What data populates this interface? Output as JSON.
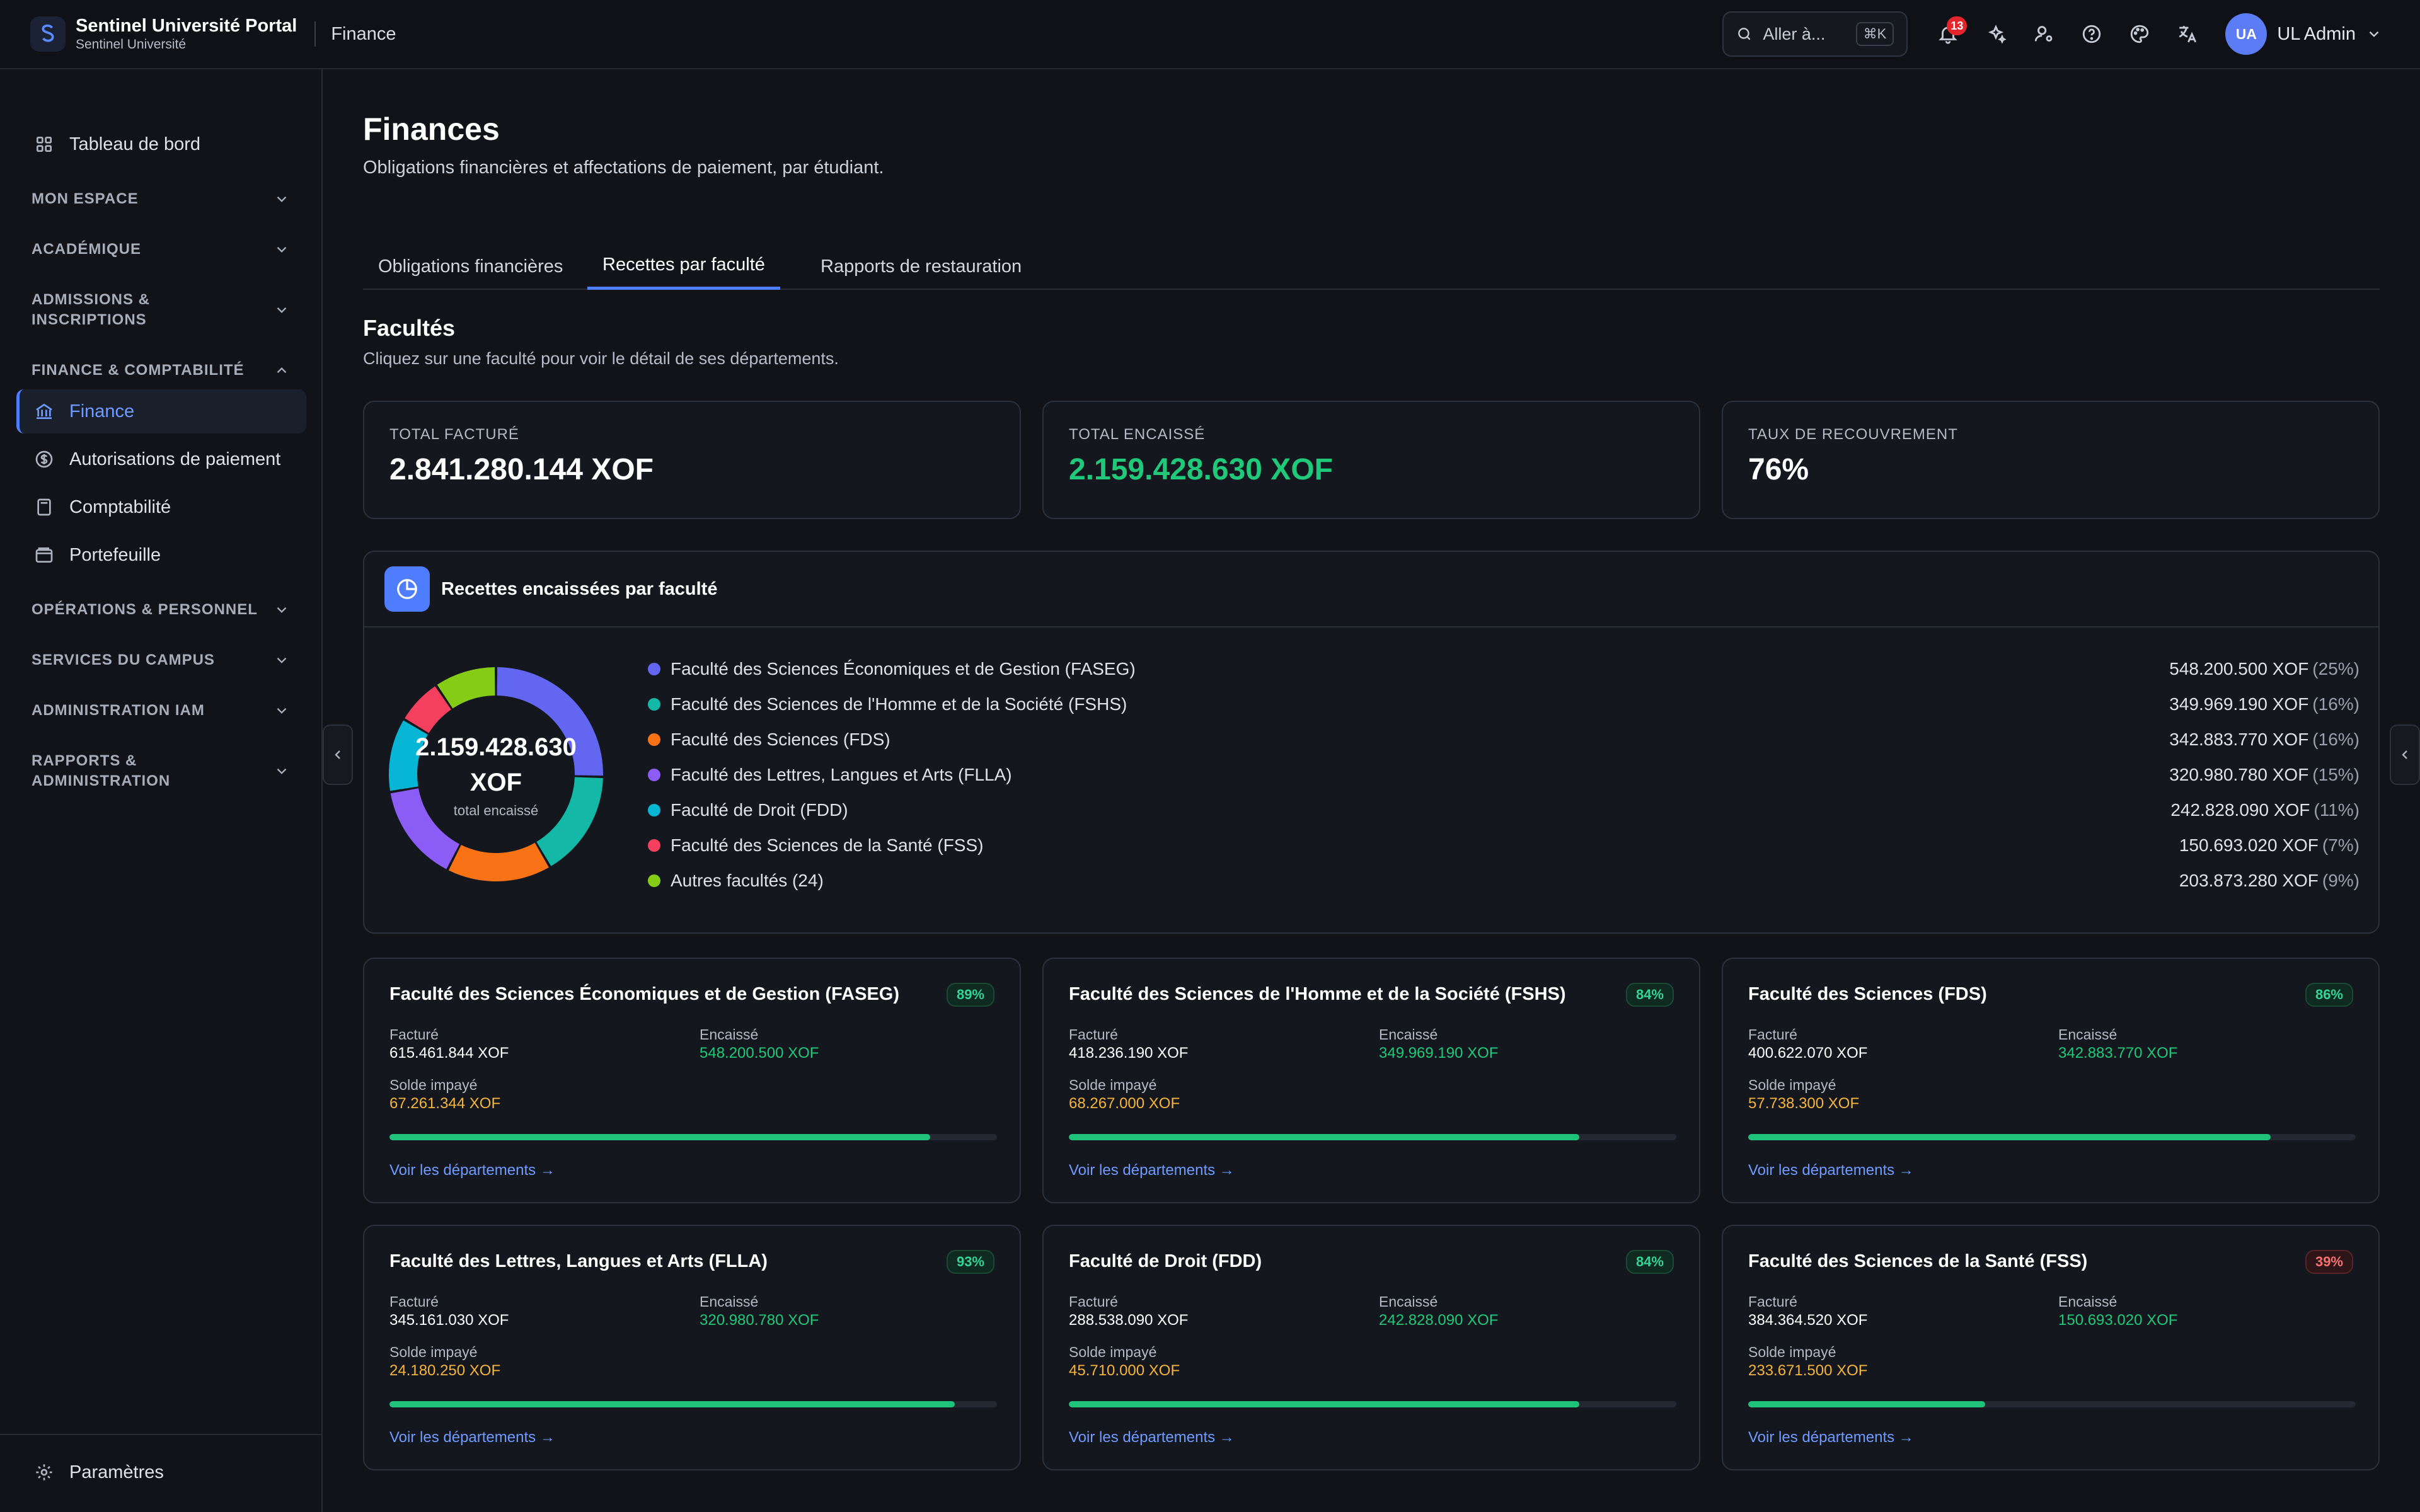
{
  "app": {
    "title": "Sentinel Université Portal",
    "subtitle": "Sentinel Université",
    "section": "Finance"
  },
  "topbar": {
    "search_label": "Aller à...",
    "search_shortcut": "⌘K",
    "notifications_count": "13",
    "user_initials": "UA",
    "user_name": "UL Admin"
  },
  "sidebar": {
    "dashboard": "Tableau de bord",
    "groups": {
      "mon_espace": "MON ESPACE",
      "academique": "ACADÉMIQUE",
      "admissions_l1": "ADMISSIONS &",
      "admissions_l2": "INSCRIPTIONS",
      "finance": "FINANCE & COMPTABILITÉ",
      "operations": "OPÉRATIONS & PERSONNEL",
      "services": "SERVICES DU CAMPUS",
      "iam": "ADMINISTRATION IAM",
      "rapports_l1": "RAPPORTS &",
      "rapports_l2": "ADMINISTRATION"
    },
    "finance_items": [
      "Finance",
      "Autorisations de paiement",
      "Comptabilité",
      "Portefeuille"
    ],
    "settings": "Paramètres"
  },
  "page": {
    "title": "Finances",
    "subtitle": "Obligations financières et affectations de paiement, par étudiant.",
    "tabs": [
      "Obligations financières",
      "Recettes par faculté",
      "Rapports de restauration"
    ],
    "active_tab": "Recettes par faculté",
    "section_title": "Facultés",
    "section_subtitle": "Cliquez sur une faculté pour voir le détail de ses départements."
  },
  "stats": [
    {
      "label": "TOTAL FACTURÉ",
      "value": "2.841.280.144 XOF"
    },
    {
      "label": "TOTAL ENCAISSÉ",
      "value": "2.159.428.630 XOF"
    },
    {
      "label": "TAUX DE RECOUVREMENT",
      "value": "76%"
    }
  ],
  "chart_data": {
    "type": "pie",
    "title": "Recettes encaissées par faculté",
    "center_value": "2.159.428.630",
    "center_unit": "XOF",
    "center_label": "total encaissé",
    "categories": [
      "Faculté des Sciences Économiques et de Gestion (FASEG)",
      "Faculté des Sciences de l'Homme et de la Société (FSHS)",
      "Faculté des Sciences (FDS)",
      "Faculté des Lettres, Langues et Arts (FLLA)",
      "Faculté de Droit (FDD)",
      "Faculté des Sciences de la Santé (FSS)",
      "Autres facultés (24)"
    ],
    "values": [
      548200500,
      349969190,
      342883770,
      320980780,
      242828090,
      150693020,
      203873280
    ],
    "value_labels": [
      "548.200.500 XOF",
      "349.969.190 XOF",
      "342.883.770 XOF",
      "320.980.780 XOF",
      "242.828.090 XOF",
      "150.693.020 XOF",
      "203.873.280 XOF"
    ],
    "percent_labels": [
      "(25%)",
      "(16%)",
      "(16%)",
      "(15%)",
      "(11%)",
      "(7%)",
      "(9%)"
    ],
    "colors": [
      "#6366f1",
      "#14b8a6",
      "#f97316",
      "#8b5cf6",
      "#06b6d4",
      "#f43f5e",
      "#84cc16"
    ],
    "legend": "right"
  },
  "labels": {
    "billed": "Facturé",
    "collected": "Encaissé",
    "unpaid": "Solde impayé",
    "link": "Voir les départements →"
  },
  "faculties": [
    {
      "name": "Faculté des Sciences Économiques et de Gestion (FASEG)",
      "rate": "89%",
      "rate_value": 0.89,
      "billed": "615.461.844 XOF",
      "collected": "548.200.500 XOF",
      "unpaid": "67.261.344 XOF"
    },
    {
      "name": "Faculté des Sciences de l'Homme et de la Société (FSHS)",
      "rate": "84%",
      "rate_value": 0.84,
      "billed": "418.236.190 XOF",
      "collected": "349.969.190 XOF",
      "unpaid": "68.267.000 XOF"
    },
    {
      "name": "Faculté des Sciences (FDS)",
      "rate": "86%",
      "rate_value": 0.86,
      "billed": "400.622.070 XOF",
      "collected": "342.883.770 XOF",
      "unpaid": "57.738.300 XOF"
    },
    {
      "name": "Faculté des Lettres, Langues et Arts (FLLA)",
      "rate": "93%",
      "rate_value": 0.93,
      "billed": "345.161.030 XOF",
      "collected": "320.980.780 XOF",
      "unpaid": "24.180.250 XOF"
    },
    {
      "name": "Faculté de Droit (FDD)",
      "rate": "84%",
      "rate_value": 0.84,
      "billed": "288.538.090 XOF",
      "collected": "242.828.090 XOF",
      "unpaid": "45.710.000 XOF"
    },
    {
      "name": "Faculté des Sciences de la Santé (FSS)",
      "rate": "39%",
      "rate_value": 0.39,
      "billed": "384.364.520 XOF",
      "collected": "150.693.020 XOF",
      "unpaid": "233.671.500 XOF"
    }
  ],
  "icons": {
    "logo": "shield-s-icon",
    "search": "search-icon",
    "bell": "bell-icon",
    "sparkles": "sparkles-icon",
    "user_cog": "user-cog-icon",
    "help": "help-icon",
    "palette": "palette-icon",
    "translate": "translate-icon",
    "pie": "pie-chart-icon"
  }
}
